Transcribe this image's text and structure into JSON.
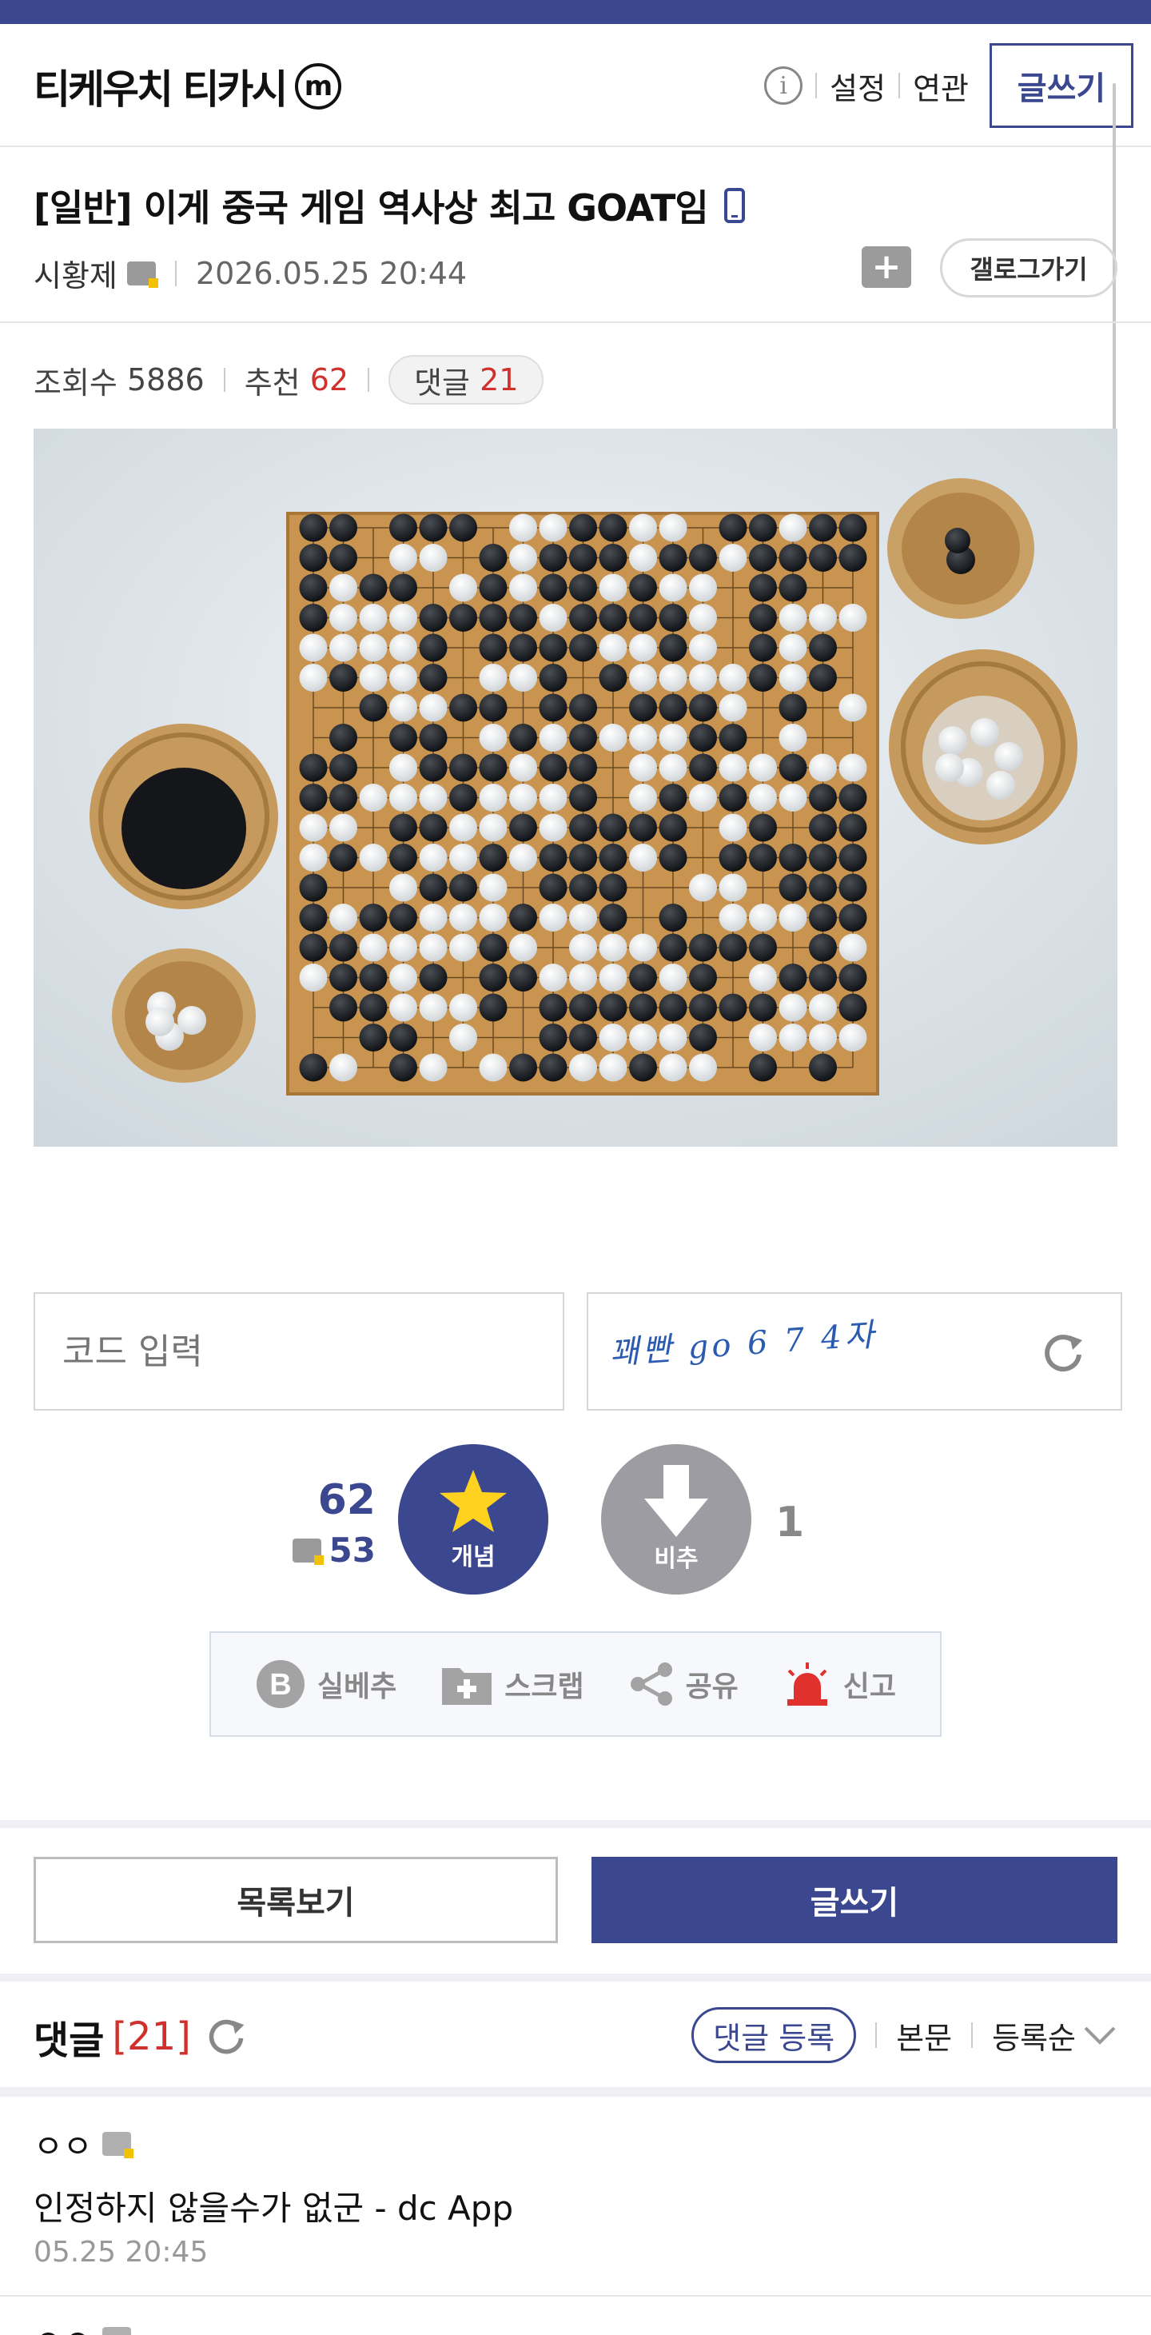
{
  "header": {
    "gallery_name": "티케우치 티카시",
    "gallery_badge": "m",
    "settings": "설정",
    "related": "연관",
    "write": "글쓰기"
  },
  "post": {
    "category": "[일반]",
    "title": "이게 중국 게임 역사상 최고 GOAT임",
    "author": "시황제",
    "date": "2026.05.25 20:44",
    "gallog": "갤로그가기",
    "views_label": "조회수",
    "views": "5886",
    "recommend_label": "추천",
    "recommend": "62",
    "comments_label": "댓글",
    "comments": "21"
  },
  "captcha": {
    "placeholder": "코드 입력",
    "text": "꽤빤 go 6 7 4자"
  },
  "vote": {
    "up_count": "62",
    "fix_count": "53",
    "up_label": "개념",
    "down_label": "비추",
    "down_count": "1"
  },
  "actions": {
    "sbc": "실베추",
    "scrap": "스크랩",
    "share": "공유",
    "report": "신고"
  },
  "buttons": {
    "list": "목록보기",
    "write": "글쓰기"
  },
  "comments_section": {
    "title": "댓글",
    "count": "[21]",
    "register": "댓글 등록",
    "body_link": "본문",
    "sort": "등록순"
  },
  "comments": [
    {
      "nick": "ㅇㅇ",
      "body": "인정하지 않을수가 없군 - dc App",
      "date": "05.25 20:45"
    },
    {
      "nick": "ㅇㅇ"
    }
  ],
  "colors": {
    "brand": "#3b4890",
    "accent_red": "#d0312d",
    "down_gray": "#9d9ca3"
  }
}
